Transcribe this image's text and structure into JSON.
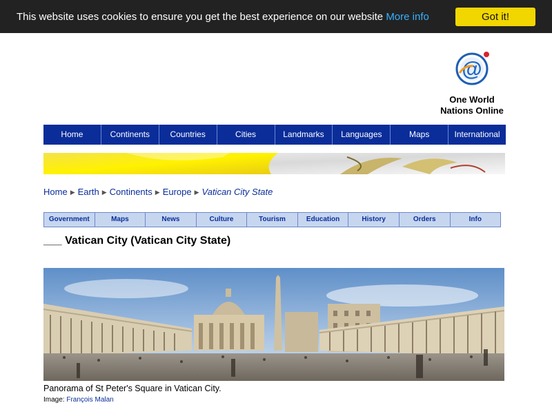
{
  "cookie_banner": {
    "message": "This website uses cookies to ensure you get the best experience on our website",
    "more_info": "More info",
    "accept": "Got it!"
  },
  "header": {
    "logo_icon": "at-sign-globe-icon",
    "brand_line1": "One World",
    "brand_line2": "Nations Online"
  },
  "main_nav": [
    "Home",
    "Continents",
    "Countries",
    "Cities",
    "Landmarks",
    "Languages",
    "Maps",
    "International"
  ],
  "breadcrumb": {
    "items": [
      "Home",
      "Earth",
      "Continents",
      "Europe"
    ],
    "current": "Vatican City State"
  },
  "sub_nav": [
    "Government",
    "Maps",
    "News",
    "Culture",
    "Tourism",
    "Education",
    "History",
    "Orders",
    "Info"
  ],
  "title": "___ Vatican City (Vatican City State)",
  "photo": {
    "caption": "Panorama of St Peter's Square in Vatican City.",
    "credit_label": "Image:",
    "credit_name": "François Malan"
  },
  "colors": {
    "nav_blue": "#0b2d9a",
    "cookie_bg": "#222222",
    "cookie_button": "#f1d600",
    "subnav_bg": "#c6d6ef"
  }
}
